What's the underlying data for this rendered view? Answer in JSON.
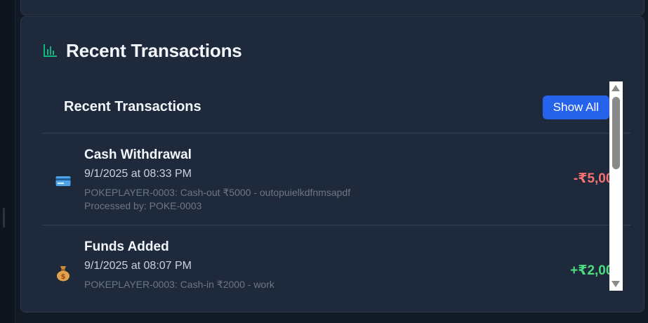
{
  "section": {
    "title": "Recent Transactions",
    "icon": "bar-chart-icon",
    "accent_color": "#10b981"
  },
  "list": {
    "title": "Recent Transactions",
    "show_all_label": "Show All",
    "button_color": "#2563eb"
  },
  "transactions": [
    {
      "icon": "credit-card-icon",
      "name": "Cash Withdrawal",
      "time": "9/1/2025 at 08:33 PM",
      "description": "POKEPLAYER-0003: Cash-out ₹5000 - outopuielkdfnmsapdf",
      "processed_by": "Processed by: POKE-0003",
      "amount": "-₹5,000",
      "amount_color": "#f87171"
    },
    {
      "icon": "money-bag-icon",
      "name": "Funds Added",
      "time": "9/1/2025 at 08:07 PM",
      "description": "POKEPLAYER-0003: Cash-in ₹2000 - work",
      "amount": "+₹2,000",
      "amount_color": "#4ade80"
    }
  ]
}
